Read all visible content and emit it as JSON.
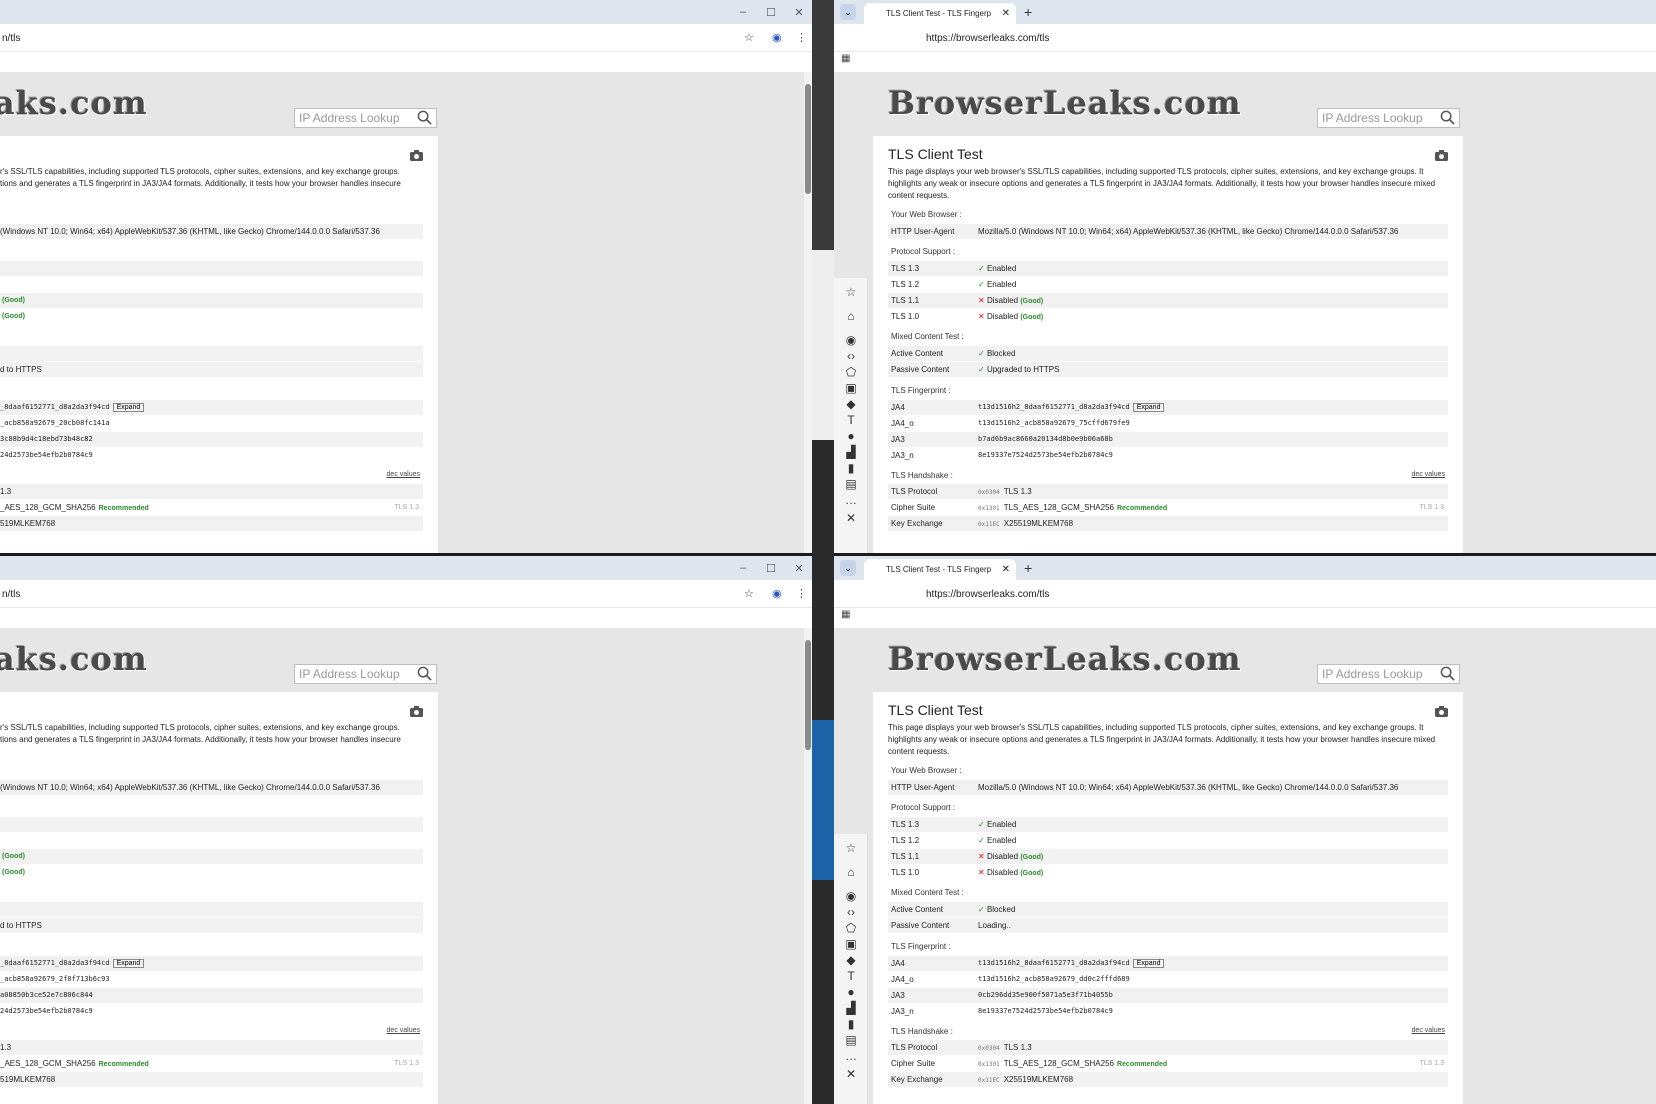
{
  "window_controls": {
    "minimize": "–",
    "maximize": "☐",
    "close": "✕"
  },
  "tab": {
    "title": "TLS Client Test - TLS Fingerp",
    "close": "✕",
    "new": "+"
  },
  "address": {
    "left_url": "n/tls",
    "right_url": "https://browserleaks.com/tls"
  },
  "site": {
    "logo": "BrowserLeaks.com",
    "left_logo": "aks.com",
    "search_placeholder": "IP Address Lookup"
  },
  "page": {
    "title": "TLS Client Test",
    "intro_full": "This page displays your web browser's SSL/TLS capabilities, including supported TLS protocols, cipher suites, extensions, and key exchange groups. It highlights any weak or insecure options and generates a TLS fingerprint in JA3/JA4 formats. Additionally, it tests how your browser handles insecure mixed content requests.",
    "intro_left_1": "r's SSL/TLS capabilities, including supported TLS protocols, cipher suites, extensions, and key exchange groups.",
    "intro_left_2": "tions and generates a TLS fingerprint in JA3/JA4 formats. Additionally, it tests how your browser handles insecure",
    "section_browser": "Your Web Browser :",
    "ua_label": "HTTP User-Agent",
    "ua_value": "Mozilla/5.0 (Windows NT 10.0; Win64; x64) AppleWebKit/537.36 (KHTML, like Gecko) Chrome/144.0.0.0 Safari/537.36",
    "ua_left": "(Windows NT 10.0; Win64; x64) AppleWebKit/537.36 (KHTML, like Gecko) Chrome/144.0.0.0 Safari/537.36",
    "section_protocol": "Protocol Support :",
    "protocols": [
      {
        "name": "TLS 1.3",
        "status": "Enabled",
        "good": ""
      },
      {
        "name": "TLS 1.2",
        "status": "Enabled",
        "good": ""
      },
      {
        "name": "TLS 1.1",
        "status": "Disabled",
        "good": "(Good)"
      },
      {
        "name": "TLS 1.0",
        "status": "Disabled",
        "good": "(Good)"
      }
    ],
    "good_label": "(Good)",
    "section_mixed": "Mixed Content Test :",
    "active_label": "Active Content",
    "active_value": "Blocked",
    "passive_label": "Passive Content",
    "passive_value_top": "Upgraded to HTTPS",
    "passive_value_bottom": "Loading..",
    "passive_left": "d to HTTPS",
    "section_fp": "TLS Fingerprint :",
    "expand": "Expand",
    "fp_labels": [
      "JA4",
      "JA4_o",
      "JA3",
      "JA3_n"
    ],
    "fp_top": [
      "t13d1516h2_8daaf6152771_d8a2da3f94cd",
      "t13d1516h2_acb858a92679_75cffd679fe9",
      "b7ad6b9ac8660a20134d8b0e9b06a68b",
      "8e19337e7524d2573be54efb2b0784c9"
    ],
    "fp_bottom": [
      "t13d1516h2_8daaf6152771_d8a2da3f94cd",
      "t13d1516h2_acb858a92679_dd0c2fffd689",
      "0cb296dd35e900f5071a5e3f71b4055b",
      "8e19337e7524d2573be54efb2b0784c9"
    ],
    "fp_left_top": [
      "_8daaf6152771_d8a2da3f94cd",
      "_acb858a92679_20cb08fc141a",
      "3c88b9d4c18ebd73b48c82",
      "24d2573be54efb2b0784c9"
    ],
    "fp_left_bottom": [
      "_8daaf6152771_d8a2da3f94cd",
      "_acb858a92679_2f0f713b6c93",
      "a08850b3ce52e7c806c844",
      "24d2573be54efb2b0784c9"
    ],
    "section_handshake": "TLS Handshake :",
    "dec_values": "dec values",
    "hs_protocol_label": "TLS Protocol",
    "hs_protocol_hex": "0x0304",
    "hs_protocol_value": "TLS 1.3",
    "hs_protocol_left": "1.3",
    "hs_cipher_label": "Cipher Suite",
    "hs_cipher_hex": "0x1301",
    "hs_cipher_value": "TLS_AES_128_GCM_SHA256",
    "hs_cipher_left": "_AES_128_GCM_SHA256",
    "recommended": "Recommended",
    "hs_cipher_tag": "TLS 1.3",
    "hs_kex_label": "Key Exchange",
    "hs_kex_hex": "0x11EC",
    "hs_kex_value": "X25519MLKEM768",
    "hs_kex_left": "519MLKEM768"
  },
  "colors": {
    "accent": "#2a8c2a",
    "error": "#dd1111"
  }
}
